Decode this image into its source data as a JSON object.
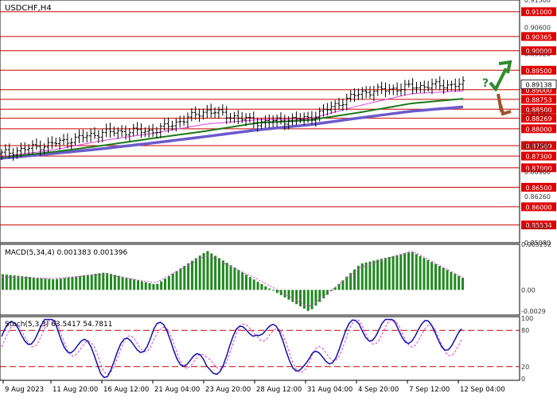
{
  "main_panel": {
    "title": "USDCHF,H4",
    "price_labels": [
      "0.91300",
      "0.90600",
      "0.89920",
      "0.89138",
      "0.88380",
      "0.87600",
      "0.87520",
      "0.86900",
      "0.86260",
      "0.85487",
      "0.85080"
    ],
    "current_price": "0.89138",
    "levels": [
      {
        "label": "0.91000",
        "value": 0.91
      },
      {
        "label": "0.90365",
        "value": 0.90365
      },
      {
        "label": "0.90000",
        "value": 0.9
      },
      {
        "label": "0.89500",
        "value": 0.895
      },
      {
        "label": "0.89000",
        "value": 0.89
      },
      {
        "label": "0.88753",
        "value": 0.88753
      },
      {
        "label": "0.88500",
        "value": 0.885
      },
      {
        "label": "0.88269",
        "value": 0.88269
      },
      {
        "label": "0.88000",
        "value": 0.88
      },
      {
        "label": "0.87569",
        "value": 0.87569
      },
      {
        "label": "0.87300",
        "value": 0.873
      },
      {
        "label": "0.87000",
        "value": 0.87
      },
      {
        "label": "0.86500",
        "value": 0.865
      },
      {
        "label": "0.86000",
        "value": 0.86
      },
      {
        "label": "0.85534",
        "value": 0.85534
      }
    ],
    "question_mark": "?"
  },
  "macd_panel": {
    "title": "MACD(5,34,4) 0.001383 0.001396",
    "scale_labels": [
      "0.005252",
      "0.00",
      "-0.0029"
    ]
  },
  "stoch_panel": {
    "title": "Stoch(5,3,3) 63.5417 54.7811",
    "scale_labels": [
      "100",
      "80",
      "20",
      "0"
    ]
  },
  "time_labels": [
    "9 Aug 2023",
    "11 Aug 20:00",
    "16 Aug 12:00",
    "21 Aug 04:00",
    "23 Aug 20:00",
    "28 Aug 12:00",
    "31 Aug 04:00",
    "4 Sep 20:00",
    "7 Sep 12:00",
    "12 Sep 04:00"
  ],
  "colors": {
    "level_line": "#cc0000",
    "label_bg": "#e00000",
    "price": "#000000",
    "ma_fast": "#e040e0",
    "ma_mid": "#1a7a1a",
    "ma_slow": "#6a5acd",
    "macd_hist": "#1f8a1f",
    "macd_signal": "#e040e0",
    "stoch_main": "#1010b0",
    "stoch_signal": "#e040e0",
    "arrow_up": "#2e8b2e",
    "arrow_down": "#a0522d",
    "question": "#2e8b2e"
  },
  "chart_data": [
    {
      "type": "line",
      "title": "USDCHF,H4",
      "ylim": [
        0.8508,
        0.913
      ],
      "x": [
        "9 Aug 2023",
        "11 Aug 20:00",
        "16 Aug 12:00",
        "21 Aug 04:00",
        "23 Aug 20:00",
        "28 Aug 12:00",
        "31 Aug 04:00",
        "4 Sep 20:00",
        "7 Sep 12:00",
        "12 Sep 04:00"
      ],
      "series": [
        {
          "values": [
            0.8736,
            0.8762,
            0.8791,
            0.8795,
            0.8847,
            0.8816,
            0.8827,
            0.8893,
            0.8908,
            0.8914
          ]
        },
        {
          "values": [
            0.8728,
            0.8745,
            0.877,
            0.8789,
            0.8812,
            0.8823,
            0.8825,
            0.886,
            0.889,
            0.8897
          ]
        },
        {
          "values": [
            0.8726,
            0.874,
            0.8757,
            0.8776,
            0.8794,
            0.8815,
            0.8822,
            0.8842,
            0.8865,
            0.8877
          ]
        },
        {
          "values": [
            0.8724,
            0.8736,
            0.8749,
            0.8764,
            0.878,
            0.8797,
            0.881,
            0.8828,
            0.8845,
            0.8856
          ]
        }
      ]
    },
    {
      "type": "bar",
      "title": "MACD(5,34,4)",
      "ylim": [
        -0.0029,
        0.005252
      ],
      "x": [
        "9 Aug 2023",
        "11 Aug 20:00",
        "16 Aug 12:00",
        "21 Aug 04:00",
        "23 Aug 20:00",
        "28 Aug 12:00",
        "31 Aug 04:00",
        "4 Sep 20:00",
        "7 Sep 12:00",
        "12 Sep 04:00"
      ],
      "series": [
        {
          "name": "MACD",
          "values": [
            0.0018,
            0.0012,
            0.002,
            0.0006,
            0.0045,
            0.0009,
            -0.0025,
            0.003,
            0.0044,
            0.001383
          ]
        },
        {
          "name": "Signal",
          "values": [
            0.0015,
            0.0013,
            0.0018,
            0.0008,
            0.004,
            0.0012,
            -0.002,
            0.0026,
            0.0045,
            0.001396
          ]
        }
      ]
    },
    {
      "type": "line",
      "title": "Stoch(5,3,3)",
      "ylim": [
        0,
        100
      ],
      "x": [
        "9 Aug 2023",
        "11 Aug 20:00",
        "16 Aug 12:00",
        "21 Aug 04:00",
        "23 Aug 20:00",
        "28 Aug 12:00",
        "31 Aug 04:00",
        "4 Sep 20:00",
        "7 Sep 12:00",
        "12 Sep 04:00"
      ],
      "levels": [
        80,
        20
      ],
      "series": [
        {
          "name": "Main",
          "values": [
            70,
            85,
            20,
            80,
            10,
            95,
            15,
            85,
            80,
            63.5417
          ]
        },
        {
          "name": "Signal",
          "values": [
            65,
            80,
            25,
            75,
            15,
            90,
            20,
            80,
            75,
            54.7811
          ]
        }
      ]
    }
  ]
}
